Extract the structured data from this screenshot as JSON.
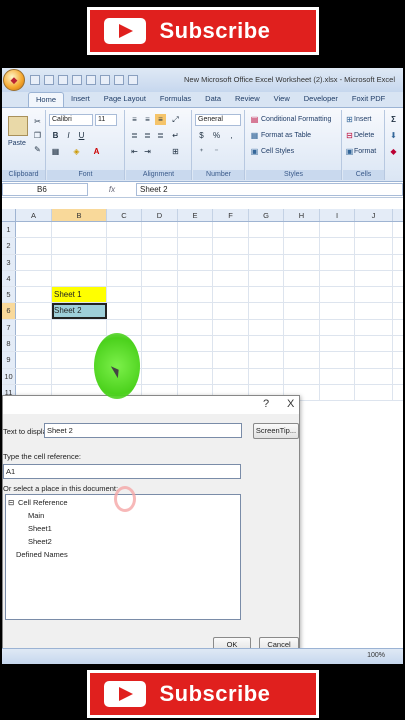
{
  "banner": {
    "subscribe_label": "Subscribe"
  },
  "window": {
    "title": "New Microsoft Office Excel Worksheet (2).xlsx - Microsoft Excel"
  },
  "tabs": [
    "Home",
    "Insert",
    "Page Layout",
    "Formulas",
    "Data",
    "Review",
    "View",
    "Developer",
    "Foxit PDF"
  ],
  "ribbon": {
    "clipboard": {
      "label": "Clipboard",
      "paste": "Paste"
    },
    "font": {
      "label": "Font",
      "name": "Calibri",
      "size": "11",
      "bold": "B",
      "italic": "I",
      "underline": "U",
      "font_color": "A"
    },
    "alignment": {
      "label": "Alignment"
    },
    "number": {
      "label": "Number",
      "format": "General",
      "currency": "$",
      "percent": "%",
      "comma": ","
    },
    "styles": {
      "label": "Styles",
      "conditional": "Conditional Formatting",
      "format_table": "Format as Table",
      "cell_styles": "Cell Styles"
    },
    "cells": {
      "label": "Cells",
      "insert": "Insert",
      "delete": "Delete",
      "format": "Format"
    },
    "editing": {
      "sum": "Σ"
    }
  },
  "formula_bar": {
    "cell_ref": "B6",
    "fx": "fx",
    "content": "Sheet 2"
  },
  "columns": [
    "A",
    "B",
    "C",
    "D",
    "E",
    "F",
    "G",
    "H",
    "I",
    "J"
  ],
  "selected_column": "B",
  "rows": [
    "1",
    "2",
    "3",
    "4",
    "5",
    "6",
    "7",
    "8",
    "9",
    "10",
    "11"
  ],
  "cells": {
    "B5": "Sheet 1",
    "B6": "Sheet 2"
  },
  "dialog": {
    "help": "?",
    "close": "X",
    "text_to_display_label": "Text to display:",
    "text_to_display_value": "Sheet 2",
    "screentip_button": "ScreenTip...",
    "cell_ref_label": "Type the cell reference:",
    "cell_ref_value": "A1",
    "place_label": "Or select a place in this document:",
    "tree": {
      "root": "Cell Reference",
      "items": [
        "Main",
        "Sheet1",
        "Sheet2"
      ],
      "defined": "Defined Names"
    },
    "ok": "OK",
    "cancel": "Cancel"
  },
  "status": {
    "zoom": "100%"
  },
  "colors": {
    "accent_red": "#e0201e",
    "yellow_cell": "#ffff00",
    "teal_cell": "#9ecfd9",
    "pointer_green": "#4bd11c"
  }
}
